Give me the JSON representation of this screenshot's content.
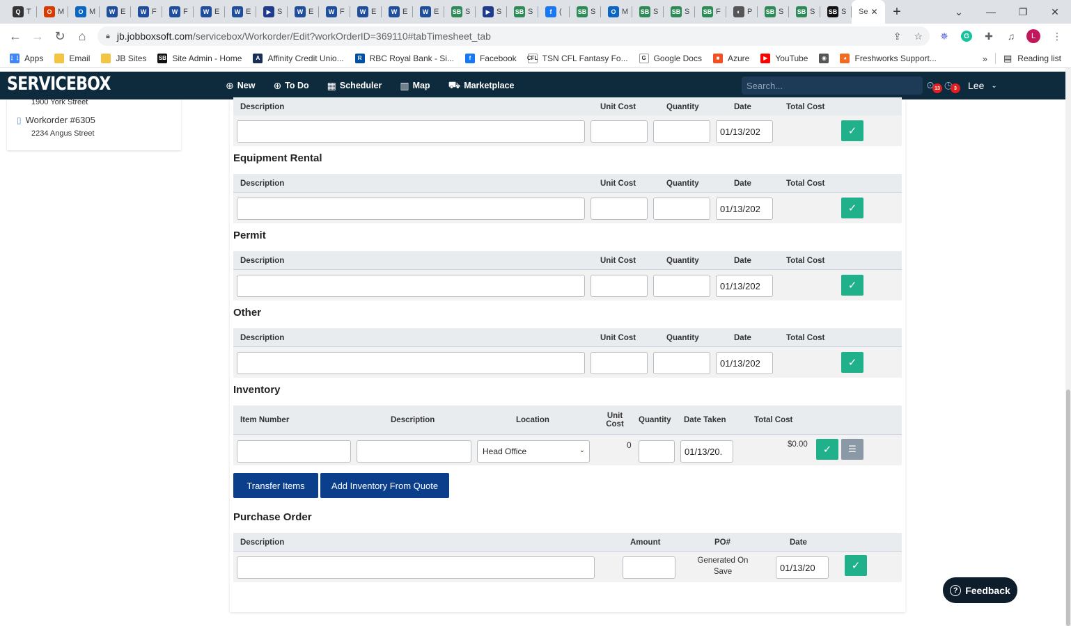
{
  "browser": {
    "tabs": [
      {
        "title": "T",
        "fav": "Q",
        "color": "#333333"
      },
      {
        "title": "M",
        "fav": "O",
        "color": "#d83b01"
      },
      {
        "title": "M",
        "fav": "O",
        "color": "#0a66c2"
      },
      {
        "title": "E",
        "fav": "W",
        "color": "#1f4e9c"
      },
      {
        "title": "F",
        "fav": "W",
        "color": "#1f4e9c"
      },
      {
        "title": "F",
        "fav": "W",
        "color": "#1f4e9c"
      },
      {
        "title": "E",
        "fav": "W",
        "color": "#1f4e9c"
      },
      {
        "title": "E",
        "fav": "W",
        "color": "#1f4e9c"
      },
      {
        "title": "S",
        "fav": "▶",
        "color": "#1f3b8c"
      },
      {
        "title": "E",
        "fav": "W",
        "color": "#1f4e9c"
      },
      {
        "title": "F",
        "fav": "W",
        "color": "#1f4e9c"
      },
      {
        "title": "E",
        "fav": "W",
        "color": "#1f4e9c"
      },
      {
        "title": "E",
        "fav": "W",
        "color": "#1f4e9c"
      },
      {
        "title": "E",
        "fav": "W",
        "color": "#1f4e9c"
      },
      {
        "title": "S",
        "fav": "SB",
        "color": "#2e8b57"
      },
      {
        "title": "S",
        "fav": "▶",
        "color": "#1f3b8c"
      },
      {
        "title": "S",
        "fav": "SB",
        "color": "#2e8b57"
      },
      {
        "title": "(",
        "fav": "f",
        "color": "#1877f2"
      },
      {
        "title": "S",
        "fav": "SB",
        "color": "#2e8b57"
      },
      {
        "title": "M",
        "fav": "O",
        "color": "#0a66c2"
      },
      {
        "title": "S",
        "fav": "SB",
        "color": "#2e8b57"
      },
      {
        "title": "S",
        "fav": "SB",
        "color": "#2e8b57"
      },
      {
        "title": "F",
        "fav": "SB",
        "color": "#2e8b57"
      },
      {
        "title": "P",
        "fav": "◐",
        "color": "#555555"
      },
      {
        "title": "S",
        "fav": "SB",
        "color": "#2e8b57"
      },
      {
        "title": "S",
        "fav": "SB",
        "color": "#2e8b57"
      },
      {
        "title": "S",
        "fav": "SB",
        "color": "#111111"
      }
    ],
    "active_tab_title": "Se",
    "url_host": "jb.jobboxsoft.com",
    "url_path": "/servicebox/Workorder/Edit?workOrderID=369110#tabTimesheet_tab",
    "bookmarks": [
      {
        "label": "Apps",
        "icon": "apps-grid-icon",
        "color": "#4285f4",
        "glyph": "⋮⋮"
      },
      {
        "label": "Email",
        "icon": "folder-icon",
        "color": "#f4c542",
        "glyph": ""
      },
      {
        "label": "JB Sites",
        "icon": "folder-icon",
        "color": "#f4c542",
        "glyph": ""
      },
      {
        "label": "Site Admin - Home",
        "icon": "servicebox-icon",
        "color": "#111111",
        "glyph": "SB"
      },
      {
        "label": "Affinity Credit Unio...",
        "icon": "affinity-icon",
        "color": "#1a2e5a",
        "glyph": "A"
      },
      {
        "label": "RBC Royal Bank - Si...",
        "icon": "rbc-icon",
        "color": "#0051a5",
        "glyph": "R"
      },
      {
        "label": "Facebook",
        "icon": "facebook-icon",
        "color": "#1877f2",
        "glyph": "f"
      },
      {
        "label": "TSN CFL Fantasy Fo...",
        "icon": "cfl-icon",
        "color": "#ffffff",
        "glyph": "CFL"
      },
      {
        "label": "Google Docs",
        "icon": "google-icon",
        "color": "#ffffff",
        "glyph": "G"
      },
      {
        "label": "Azure",
        "icon": "microsoft-icon",
        "color": "#f25022",
        "glyph": "■"
      },
      {
        "label": "YouTube",
        "icon": "youtube-icon",
        "color": "#ff0000",
        "glyph": "▶"
      },
      {
        "label": "",
        "icon": "globe-icon",
        "color": "#555555",
        "glyph": "◉"
      },
      {
        "label": "Freshworks Support...",
        "icon": "freshworks-icon",
        "color": "#f36b21",
        "glyph": "◕"
      }
    ],
    "bookmarks_more": "»",
    "reading_list": "Reading list",
    "profile_initial": "L"
  },
  "app": {
    "logo": "SERVICEBOX",
    "nav": [
      {
        "label": "New",
        "icon": "plus-circle-icon",
        "glyph": "⊕"
      },
      {
        "label": "To Do",
        "icon": "plus-circle-icon",
        "glyph": "⊕"
      },
      {
        "label": "Scheduler",
        "icon": "calendar-icon",
        "glyph": "▦"
      },
      {
        "label": "Map",
        "icon": "map-icon",
        "glyph": "▥"
      },
      {
        "label": "Marketplace",
        "icon": "cart-icon",
        "glyph": "⛟"
      }
    ],
    "search_placeholder": "Search...",
    "badge_location": "13",
    "badge_clock": "3",
    "user": "Lee"
  },
  "sidebar": {
    "addr_top": "1900 York Street",
    "workorder": "Workorder #6305",
    "addr_bottom": "2234 Angus Street"
  },
  "labels": {
    "description": "Description",
    "unit_cost": "Unit Cost",
    "quantity": "Quantity",
    "date": "Date",
    "total_cost": "Total Cost",
    "item_number": "Item Number",
    "location": "Location",
    "unit_cost_wrap1": "Unit",
    "unit_cost_wrap2": "Cost",
    "date_taken": "Date Taken",
    "amount": "Amount",
    "po_number": "PO#",
    "date_value": "01/13/202",
    "date_value_short": "01/13/20."
  },
  "sections": {
    "s0_title": "",
    "equipment_rental": "Equipment Rental",
    "permit": "Permit",
    "other": "Other",
    "inventory": "Inventory",
    "purchase_order": "Purchase Order"
  },
  "inventory_row": {
    "location_selected": "Head Office",
    "unit_cost": "0",
    "date_taken": "01/13/20.",
    "total_cost": "$0.00"
  },
  "buttons": {
    "transfer_items": "Transfer Items",
    "add_inventory_from_quote": "Add Inventory From Quote",
    "feedback": "Feedback"
  },
  "purchase_order_row": {
    "po_text": "Generated On Save",
    "date": "01/13/20"
  },
  "colors": {
    "header_bg": "#0e2a3d",
    "ok_button": "#20b08a",
    "primary_button": "#0b3f8c",
    "feedback_bg": "#0e1d2b"
  }
}
